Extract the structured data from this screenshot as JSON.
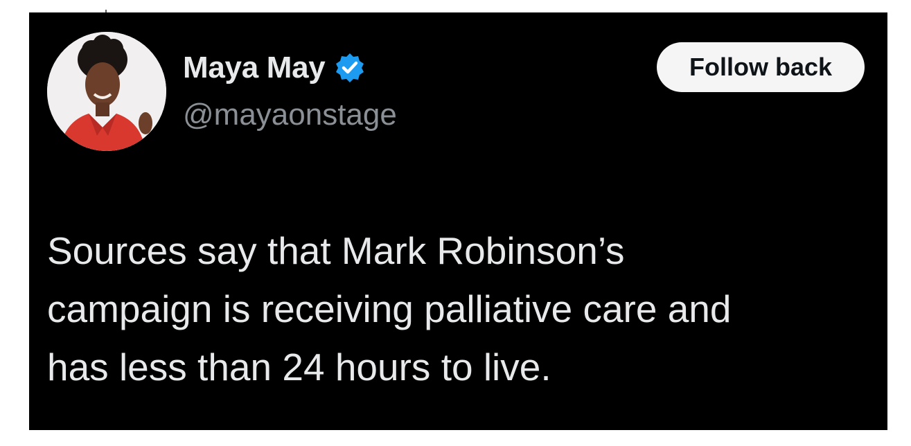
{
  "user": {
    "display_name": "Maya May",
    "handle": "@mayaonstage",
    "verified": true,
    "verified_icon": "verified-check-icon",
    "verified_color": "#1d9bf0"
  },
  "actions": {
    "follow_label": "Follow back"
  },
  "tweet": {
    "lines": [
      "Sources say that Mark Robinson’s",
      "campaign is receiving palliative care and",
      "has less than 24 hours to live."
    ]
  },
  "colors": {
    "card_background": "#000000",
    "page_background": "#ffffff",
    "text_primary": "#e7e9ea",
    "text_secondary": "#8b9096",
    "button_background": "#f5f5f5"
  }
}
